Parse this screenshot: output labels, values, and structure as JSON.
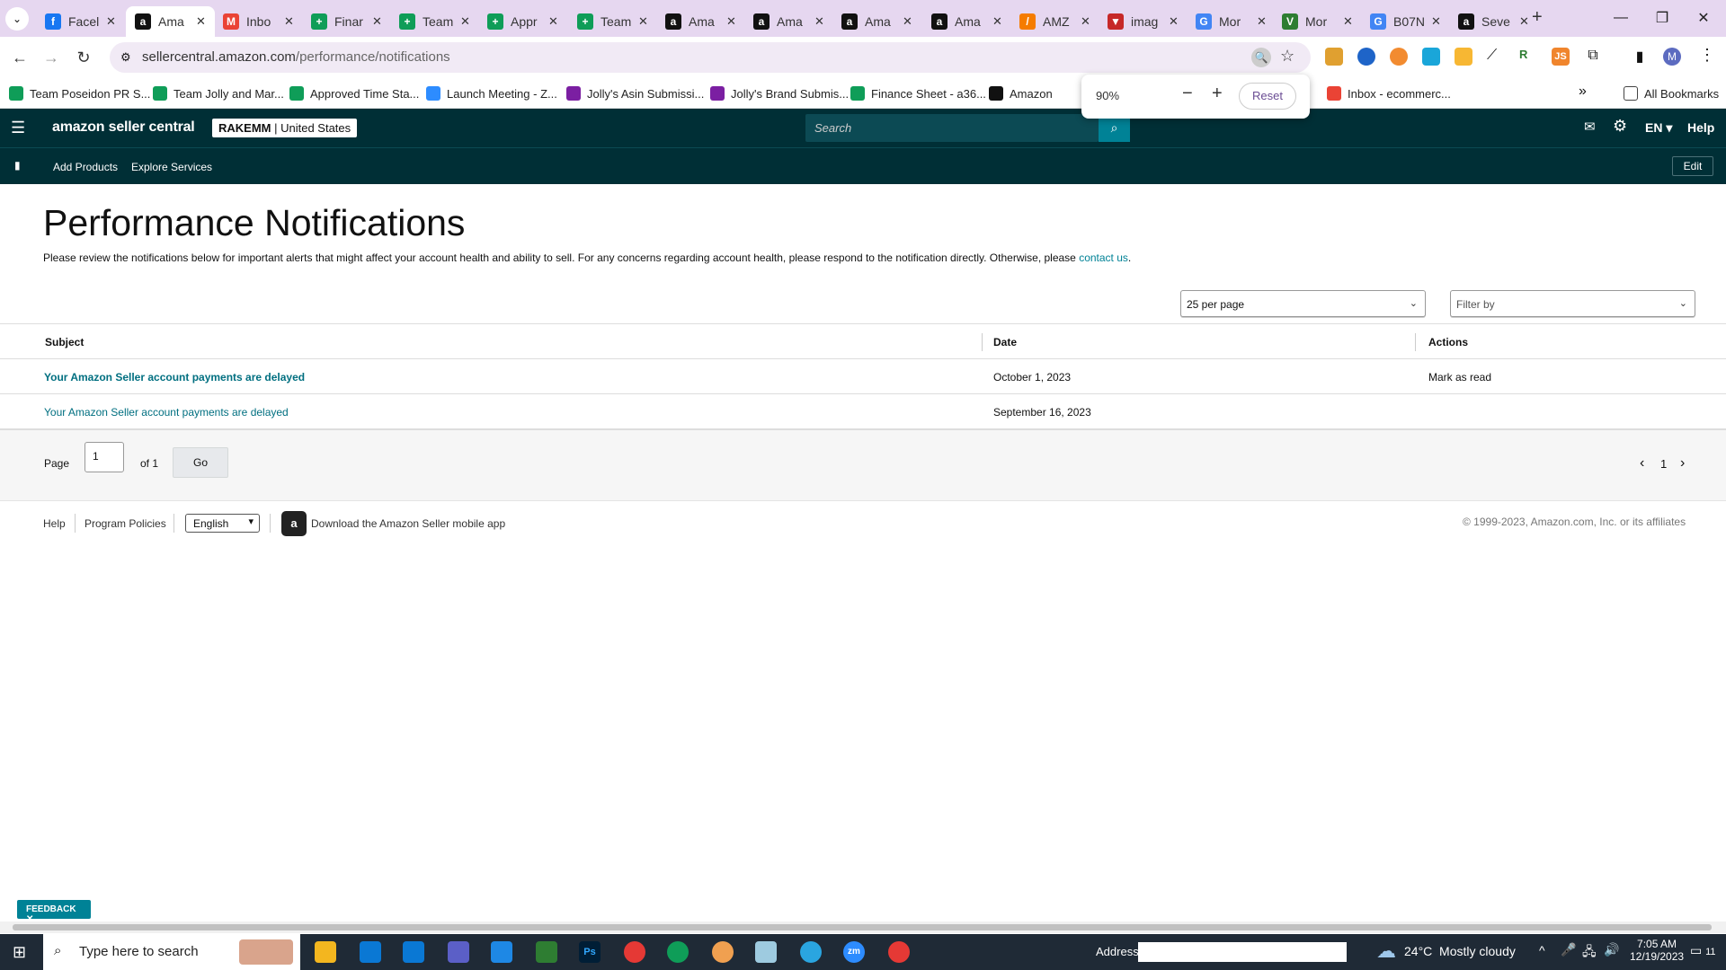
{
  "browser": {
    "tabs": [
      {
        "label": "Facel",
        "fav": "facebook-icon",
        "color": "#1877f2",
        "glyph": "f"
      },
      {
        "label": "Ama",
        "fav": "amazon-icon",
        "color": "#111",
        "glyph": "a",
        "active": true
      },
      {
        "label": "Inbo",
        "fav": "gmail-icon",
        "color": "#ea4335",
        "glyph": "M"
      },
      {
        "label": "Finar",
        "fav": "sheets-icon",
        "color": "#0f9d58",
        "glyph": "+"
      },
      {
        "label": "Team",
        "fav": "sheets-icon",
        "color": "#0f9d58",
        "glyph": "+"
      },
      {
        "label": "Appr",
        "fav": "sheets-icon",
        "color": "#0f9d58",
        "glyph": "+"
      },
      {
        "label": "Team",
        "fav": "sheets-icon",
        "color": "#0f9d58",
        "glyph": "+"
      },
      {
        "label": "Ama",
        "fav": "amazon-icon",
        "color": "#111",
        "glyph": "a"
      },
      {
        "label": "Ama",
        "fav": "amazon-icon",
        "color": "#111",
        "glyph": "a"
      },
      {
        "label": "Ama",
        "fav": "amazon-icon",
        "color": "#111",
        "glyph": "a"
      },
      {
        "label": "Ama",
        "fav": "amazon-icon",
        "color": "#111",
        "glyph": "a"
      },
      {
        "label": "AMZ",
        "fav": "amz-tool-icon",
        "color": "#f57c00",
        "glyph": "/"
      },
      {
        "label": "imag",
        "fav": "image-tool-icon",
        "color": "#c62828",
        "glyph": "▼"
      },
      {
        "label": "Mor",
        "fav": "google-icon",
        "color": "#4285f4",
        "glyph": "G"
      },
      {
        "label": "Mor",
        "fav": "monday-icon",
        "color": "#2e7d32",
        "glyph": "V"
      },
      {
        "label": "B07N",
        "fav": "google-icon",
        "color": "#4285f4",
        "glyph": "G"
      },
      {
        "label": "Seve",
        "fav": "amazon-icon",
        "color": "#111",
        "glyph": "a"
      }
    ],
    "url_host": "sellercentral.amazon.com",
    "url_path": "/performance/notifications",
    "bookmarks": [
      {
        "label": "Team Poseidon PR S...",
        "color": "#0f9d58"
      },
      {
        "label": "Team Jolly and Mar...",
        "color": "#0f9d58"
      },
      {
        "label": "Approved Time Sta...",
        "color": "#0f9d58"
      },
      {
        "label": "Launch Meeting - Z...",
        "color": "#2d8cff"
      },
      {
        "label": "Jolly's Asin Submissi...",
        "color": "#7b1fa2"
      },
      {
        "label": "Jolly's Brand Submis...",
        "color": "#7b1fa2"
      },
      {
        "label": "Finance Sheet - a36...",
        "color": "#0f9d58"
      },
      {
        "label": "Amazon",
        "color": "#111"
      },
      {
        "label": "Inbox - ecommerc...",
        "color": "#ea4335"
      }
    ],
    "all_bookmarks": "All Bookmarks",
    "zoom": {
      "level": "90%",
      "minus": "−",
      "plus": "+",
      "reset": "Reset"
    },
    "profile_initial": "M"
  },
  "header": {
    "brand": "amazon seller central",
    "store": "RAKEMM",
    "marketplace": "United States",
    "search_placeholder": "Search",
    "lang": "EN",
    "help": "Help"
  },
  "subnav": {
    "items": [
      "Add Products",
      "Explore Services"
    ],
    "edit": "Edit"
  },
  "page": {
    "title": "Performance Notifications",
    "intro": "Please review the notifications below for important alerts that might affect your account health and ability to sell. For any concerns regarding account health, please respond to the notification directly. Otherwise, please",
    "contact": "contact us",
    "per_page": "25 per page",
    "filter": "Filter by"
  },
  "table": {
    "headers": [
      "Subject",
      "Date",
      "Actions"
    ],
    "rows": [
      {
        "subject": "Your Amazon Seller account payments are delayed",
        "date": "October 1, 2023",
        "action": "Mark as read",
        "unread": true
      },
      {
        "subject": "Your Amazon Seller account payments are delayed",
        "date": "September 16, 2023",
        "action": "",
        "unread": false
      }
    ]
  },
  "pagination": {
    "page_label": "Page",
    "page_value": "1",
    "of": "of 1",
    "go": "Go",
    "current": "1"
  },
  "footer": {
    "help": "Help",
    "policies": "Program Policies",
    "language": "English",
    "app": "Download the Amazon Seller mobile app",
    "copyright": "© 1999-2023, Amazon.com, Inc. or its affiliates"
  },
  "feedback": "FEEDBACK",
  "taskbar": {
    "search_placeholder": "Type here to search",
    "address_label": "Address",
    "weather": "24°C  Mostly cloudy",
    "time": "7:05 AM",
    "date": "12/19/2023",
    "notifications": "11"
  },
  "colors": {
    "seller_header": "#002f36",
    "link": "#008296",
    "accent": "#008296"
  }
}
